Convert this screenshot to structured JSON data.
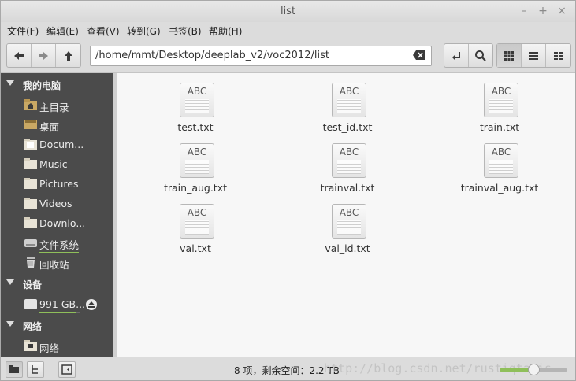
{
  "window": {
    "title": "list"
  },
  "menu": [
    "文件(F)",
    "编辑(E)",
    "查看(V)",
    "转到(G)",
    "书签(B)",
    "帮助(H)"
  ],
  "location": {
    "path": "/home/mmt/Desktop/deeplab_v2/voc2012/list"
  },
  "sidebar": {
    "sections": [
      {
        "title": "我的电脑",
        "items": [
          {
            "label": "主目录",
            "icon": "home-folder-icon"
          },
          {
            "label": "桌面",
            "icon": "desktop-icon"
          },
          {
            "label": "Docum...",
            "icon": "folder-icon"
          },
          {
            "label": "Music",
            "icon": "folder-icon"
          },
          {
            "label": "Pictures",
            "icon": "folder-icon"
          },
          {
            "label": "Videos",
            "icon": "folder-icon"
          },
          {
            "label": "Downlo...",
            "icon": "folder-icon"
          },
          {
            "label": "文件系统",
            "icon": "drive-icon"
          },
          {
            "label": "回收站",
            "icon": "trash-icon"
          }
        ]
      },
      {
        "title": "设备",
        "items": [
          {
            "label": "991 GB...",
            "icon": "disk-icon",
            "usage": 0.9
          }
        ]
      },
      {
        "title": "网络",
        "items": [
          {
            "label": "网络",
            "icon": "network-icon"
          }
        ]
      }
    ]
  },
  "files": [
    {
      "name": "test.txt"
    },
    {
      "name": "test_id.txt"
    },
    {
      "name": "train.txt"
    },
    {
      "name": "train_aug.txt"
    },
    {
      "name": "trainval.txt"
    },
    {
      "name": "trainval_aug.txt"
    },
    {
      "name": "val.txt"
    },
    {
      "name": "val_id.txt"
    }
  ],
  "file_icon_text": "ABC",
  "status": {
    "text": "8 项，剩余空间：2.2 TB",
    "watermark": "http://blog.csdn.net/rustiqtaxis",
    "zoom": 0.5
  },
  "colors": {
    "sidebar_bg": "#4b4b4b",
    "accent": "#8fbf5a",
    "content_bg": "#f7f7f7"
  }
}
